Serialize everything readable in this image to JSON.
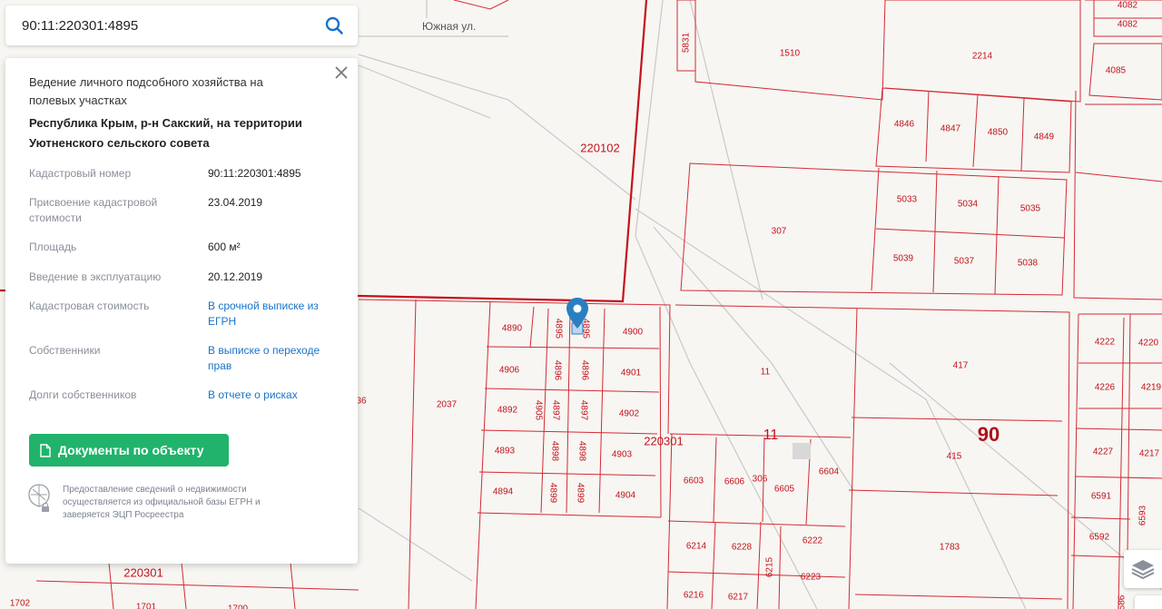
{
  "search": {
    "value": "90:11:220301:4895",
    "icon": "search-icon"
  },
  "card": {
    "title": "Ведение личного подсобного хозяйства на полевых участках",
    "address": "Республика Крым, р-н Сакский, на территории Уютненского сельского совета",
    "rows": [
      {
        "key": "Кадастровый номер",
        "value": "90:11:220301:4895",
        "link": false
      },
      {
        "key": "Присвоение кадастровой стоимости",
        "value": "23.04.2019",
        "link": false
      },
      {
        "key": "Площадь",
        "value": "600 м²",
        "link": false
      },
      {
        "key": "Введение в эксплуатацию",
        "value": "20.12.2019",
        "link": false
      },
      {
        "key": "Кадастровая стоимость",
        "value": "В срочной выписке из ЕГРН",
        "link": true
      },
      {
        "key": "Собственники",
        "value": "В выписке о переходе прав",
        "link": true
      },
      {
        "key": "Долги собственников",
        "value": "В отчете о рисках",
        "link": true
      }
    ],
    "documents_button": "Документы по объекту",
    "footer": "Предоставление сведений о недвижимости осуществляется из официальной базы ЕГРН и заверяется ЭЦП Росреестра"
  },
  "map": {
    "street": "Южная ул.",
    "quarters": [
      "220102",
      "220301",
      "220301",
      "11",
      "90"
    ],
    "parcels": [
      "4082",
      "4082",
      "5831",
      "1510",
      "2214",
      "4085",
      "4846",
      "4847",
      "4850",
      "4849",
      "5033",
      "5034",
      "5035",
      "307",
      "5039",
      "5037",
      "5038",
      "4890",
      "4895",
      "4895",
      "4900",
      "4906",
      "4896",
      "4896",
      "4901",
      "4892",
      "4905",
      "4897",
      "4897",
      "4902",
      "4893",
      "4898",
      "4898",
      "4903",
      "4894",
      "4899",
      "4899",
      "4904",
      "11",
      "417",
      "4222",
      "4220",
      "4226",
      "4219",
      "2037",
      "6603",
      "6606",
      "306",
      "6605",
      "6604",
      "415",
      "4227",
      "4217",
      "6591",
      "6593",
      "6592",
      "6214",
      "6228",
      "6215",
      "6222",
      "6223",
      "1783",
      "6216",
      "6217",
      "1702",
      "1701",
      "1700",
      "36",
      "586"
    ]
  },
  "colors": {
    "boundary": "#c3121c",
    "link": "#1a73c8",
    "button": "#21b36b",
    "marker": "#2a7fc2"
  }
}
